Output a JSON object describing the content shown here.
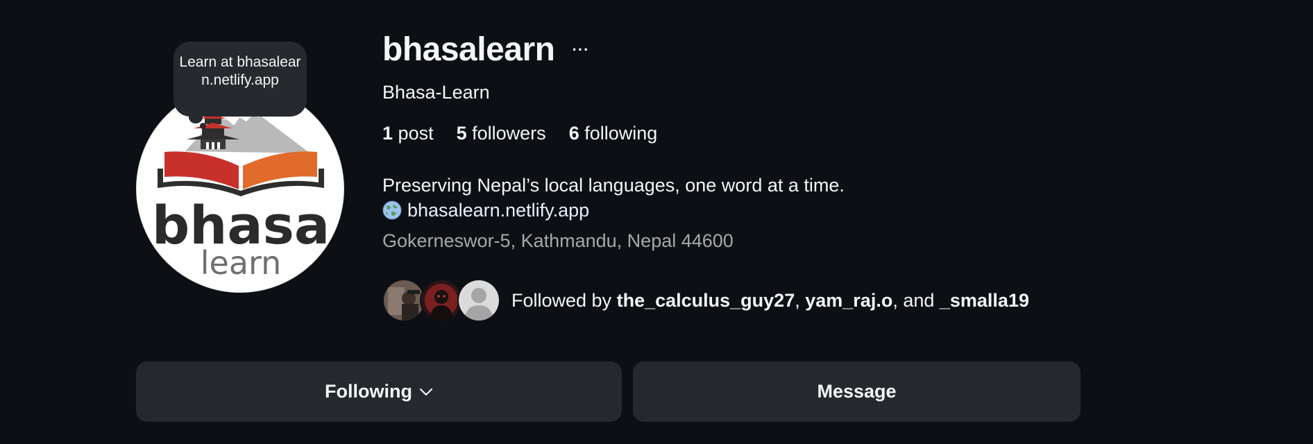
{
  "profile": {
    "username": "bhasalearn",
    "display_name": "Bhasa-Learn",
    "note": "Learn at bhasalearn.netlify.app",
    "avatar_logo": {
      "word_top": "bhasa",
      "word_bottom": "learn"
    }
  },
  "stats": {
    "posts_count": "1",
    "posts_label": "post",
    "followers_count": "5",
    "followers_label": "followers",
    "following_count": "6",
    "following_label": "following"
  },
  "bio": {
    "text": "Preserving Nepal’s local languages, one word at a time.",
    "link": "bhasalearn.netlify.app",
    "link_icon": "globe-icon",
    "address": "Gokerneswor-5, Kathmandu, Nepal 44600"
  },
  "followed_by": {
    "prefix": "Followed by",
    "users": [
      "the_calculus_guy27",
      "yam_raj.o",
      "_smalla19"
    ],
    "sep1": ", ",
    "sep2": ", and "
  },
  "actions": {
    "following_label": "Following",
    "message_label": "Message"
  },
  "colors": {
    "background": "#0c1014",
    "button_bg": "#25292e",
    "text": "#f5f5f5",
    "muted_text": "#a8a8a8",
    "logo_red": "#c8312b",
    "logo_orange": "#e06b2a",
    "logo_dark": "#2e2e2e"
  }
}
